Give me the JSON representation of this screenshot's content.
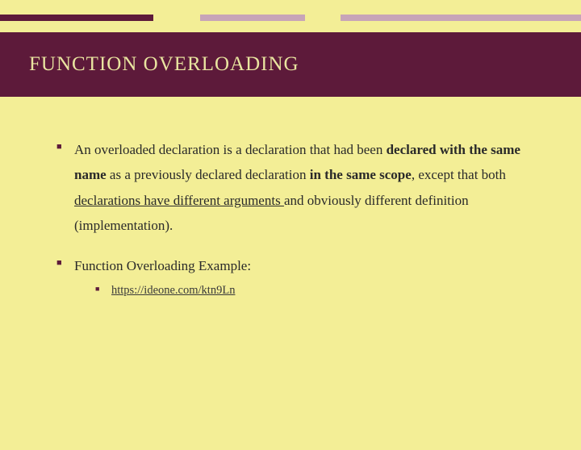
{
  "title": "FUNCTION OVERLOADING",
  "bullets": {
    "b1_part1": "An overloaded declaration is a declaration that had been ",
    "b1_bold1": "declared with the same name",
    "b1_part2": " as a previously declared declaration ",
    "b1_bold2": "in the same scope",
    "b1_part3": ", except that both ",
    "b1_underline": "declarations have different arguments ",
    "b1_part4": "and obviously different definition (implementation).",
    "b2": "Function Overloading Example:",
    "link": "https://ideone.com/ktn9Ln"
  }
}
